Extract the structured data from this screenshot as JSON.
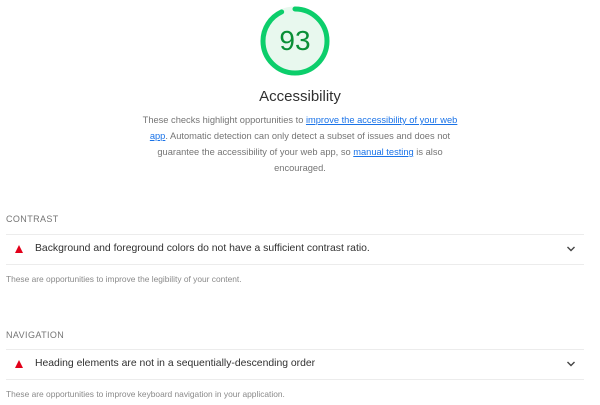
{
  "score": {
    "value": "93",
    "fraction": 0.93,
    "title": "Accessibility",
    "ring_color": "#0cce6b",
    "text_color": "#0a8f36",
    "fill_color": "#e8f8ee"
  },
  "description": {
    "part1": "These checks highlight opportunities to ",
    "link1": "improve the accessibility of your web app",
    "part2": ". Automatic detection can only detect a subset of issues and does not guarantee the accessibility of your web app, so ",
    "link2": "manual testing",
    "part3": " is also encouraged."
  },
  "groups": [
    {
      "title": "CONTRAST",
      "audit": {
        "label": "Background and foreground colors do not have a sufficient contrast ratio.",
        "status_icon": "fail-triangle-icon",
        "expand_icon": "chevron-down-icon"
      },
      "description": "These are opportunities to improve the legibility of your content."
    },
    {
      "title": "NAVIGATION",
      "audit": {
        "label": "Heading elements are not in a sequentially-descending order",
        "status_icon": "fail-triangle-icon",
        "expand_icon": "chevron-down-icon"
      },
      "description": "These are opportunities to improve keyboard navigation in your application."
    }
  ],
  "colors": {
    "fail": "#e2001a",
    "link": "#1a73e8"
  }
}
